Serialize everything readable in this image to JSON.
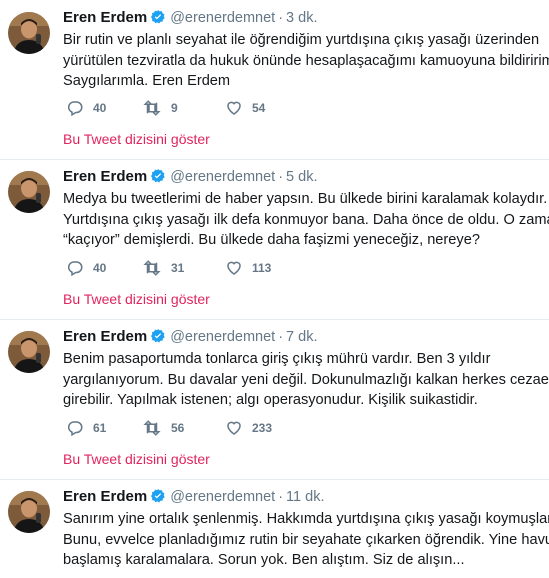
{
  "colors": {
    "accent": "#e0245e",
    "verified": "#1da1f2",
    "muted": "#657786",
    "text": "#14171a",
    "divider": "#e6ecf0"
  },
  "tweets": [
    {
      "fullname": "Eren Erdem",
      "username": "@erenerdemnet",
      "dot": "·",
      "time": "3 dk.",
      "lines": [
        "Bir rutin ve planlı seyahat ile öğrendiğim yurtdışına çıkış yasağı üzerinden",
        "yürütülen tezviratla da hukuk önünde hesaplaşacağımı kamuoyuna bildiririm.",
        "Saygılarımla. Eren Erdem"
      ],
      "replies": "40",
      "retweets": "9",
      "likes": "54",
      "show_thread": "Bu Tweet dizisini göster"
    },
    {
      "fullname": "Eren Erdem",
      "username": "@erenerdemnet",
      "dot": "·",
      "time": "5 dk.",
      "lines": [
        "Medya bu tweetlerimi de haber yapsın. Bu ülkede birini karalamak kolaydır.",
        "Yurtdışına çıkış yasağı ilk defa konmuyor bana. Daha önce de oldu. O zaman da",
        "“kaçıyor” demişlerdi. Bu ülkede daha faşizmi yeneceğiz, nereye?"
      ],
      "replies": "40",
      "retweets": "31",
      "likes": "113",
      "show_thread": "Bu Tweet dizisini göster"
    },
    {
      "fullname": "Eren Erdem",
      "username": "@erenerdemnet",
      "dot": "·",
      "time": "7 dk.",
      "lines": [
        "Benim pasaportumda tonlarca giriş çıkış mührü vardır. Ben 3 yıldır",
        "yargılanıyorum. Bu davalar yeni değil. Dokunulmazlığı kalkan herkes cezaevine",
        "girebilir. Yapılmak istenen; algı operasyonudur. Kişilik suikastidir."
      ],
      "replies": "61",
      "retweets": "56",
      "likes": "233",
      "show_thread": "Bu Tweet dizisini göster"
    },
    {
      "fullname": "Eren Erdem",
      "username": "@erenerdemnet",
      "dot": "·",
      "time": "11 dk.",
      "lines": [
        "Sanırım yine ortalık şenlenmiş. Hakkımda yurtdışına çıkış yasağı koymuşlar.",
        "Bunu, evvelce planladığımız rutin bir seyahate çıkarken öğrendik. Yine havuz",
        "başlamış karalamalara. Sorun yok. Ben alıştım. Siz de alışın..."
      ]
    }
  ]
}
